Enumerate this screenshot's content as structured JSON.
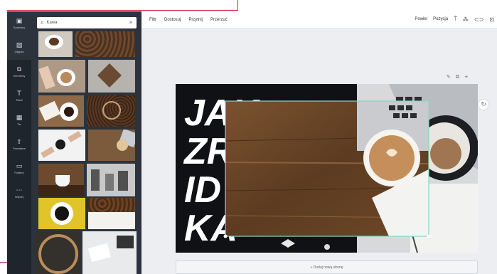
{
  "colors": {
    "annotation": "#d81e3a",
    "sidebar_bg": "#1f252d",
    "panel_bg": "#2c333c",
    "canvas_bg": "#eceef1",
    "selection": "#8fd3c6"
  },
  "sidebar": {
    "items": [
      {
        "label": "Szablony",
        "icon": "template-icon"
      },
      {
        "label": "Zdjęcia",
        "icon": "photo-icon"
      },
      {
        "label": "Elementy",
        "icon": "shapes-icon"
      },
      {
        "label": "Tekst",
        "icon": "text-icon"
      },
      {
        "label": "Tło",
        "icon": "background-icon"
      },
      {
        "label": "Przesłane",
        "icon": "upload-icon"
      },
      {
        "label": "Foldery",
        "icon": "folder-icon"
      },
      {
        "label": "Więcej",
        "icon": "more-icon"
      }
    ]
  },
  "search": {
    "value": "Kawa"
  },
  "toolbar": {
    "filter": "Filtr",
    "adjust": "Dostosuj",
    "crop": "Przytnij",
    "flip": "Przerzuć",
    "animate": "Powiel",
    "position": "Pozycja"
  },
  "design": {
    "headline_lines": [
      "JAK",
      "ZR",
      "ID",
      "KA"
    ]
  },
  "add_page_label": "+ Dodaj nową stronę"
}
